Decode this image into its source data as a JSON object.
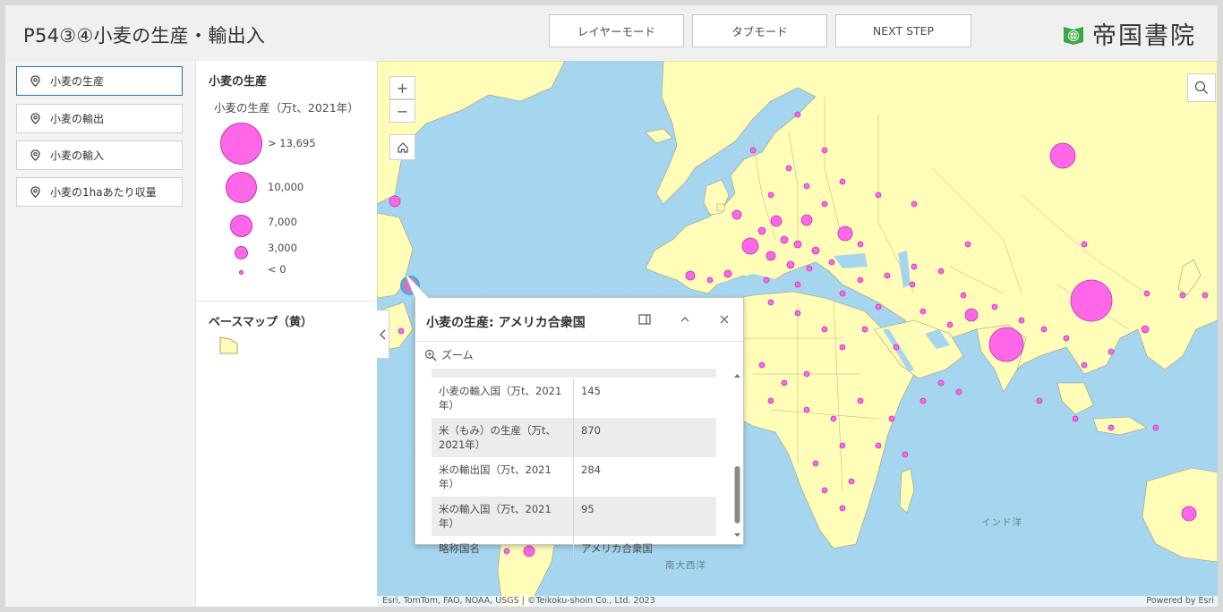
{
  "header": {
    "title": "P54③④小麦の生産・輸出入",
    "buttons": [
      "レイヤーモード",
      "タブモード",
      "NEXT STEP"
    ],
    "logo_text": "帝国書院"
  },
  "nav": {
    "items": [
      {
        "label": "小麦の生産",
        "active": true
      },
      {
        "label": "小麦の輸出",
        "active": false
      },
      {
        "label": "小麦の輸入",
        "active": false
      },
      {
        "label": "小麦の1haあたり収量",
        "active": false
      }
    ]
  },
  "legend": {
    "layer_title": "小麦の生産",
    "field_title": "小麦の生産（万t、2021年）",
    "classes": [
      {
        "label": "> 13,695"
      },
      {
        "label": "10,000"
      },
      {
        "label": "7,000"
      },
      {
        "label": "3,000"
      },
      {
        "label": "< 0"
      }
    ],
    "basemap_title": "ベースマップ（黄）",
    "colors": {
      "symbol_fill": "#ff66e8",
      "symbol_stroke": "#b53ab3",
      "land": "#fffdb8",
      "ocean": "#a6d6ef"
    }
  },
  "map": {
    "controls": {
      "zoom_in": "+",
      "zoom_out": "−"
    },
    "oceans": [
      "インド洋",
      "南大西洋"
    ],
    "attribution": "Esri, TomTom, FAO, NOAA, USGS | ©Teikoku-shoin Co., Ltd. 2023",
    "powered_by": "Powered by Esri"
  },
  "popup": {
    "title": "小麦の生産: アメリカ合衆国",
    "zoom_label": "ズーム",
    "rows": [
      {
        "key": "小麦の輸入国（万t、2021年）",
        "value": "145"
      },
      {
        "key": "米（もみ）の生産（万t、2021年）",
        "value": "870"
      },
      {
        "key": "米の輸出国（万t、2021年）",
        "value": "284"
      },
      {
        "key": "米の輸入国（万t、2021年）",
        "value": "95"
      },
      {
        "key": "略称国名",
        "value": "アメリカ合衆国"
      }
    ]
  }
}
